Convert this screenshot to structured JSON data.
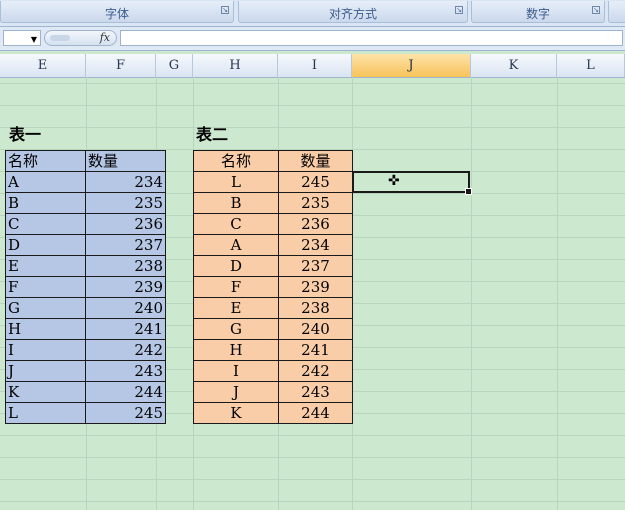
{
  "ribbon": {
    "groups": [
      {
        "label": "字体"
      },
      {
        "label": "对齐方式"
      },
      {
        "label": "数字"
      }
    ]
  },
  "formula_bar": {
    "name_box_value": "",
    "fx_label": "fx",
    "formula_value": ""
  },
  "columns": [
    "E",
    "F",
    "G",
    "H",
    "I",
    "J",
    "K",
    "L"
  ],
  "selected_column": "J",
  "table1": {
    "title": "表一",
    "headers": [
      "名称",
      "数量"
    ],
    "rows": [
      [
        "A",
        "234"
      ],
      [
        "B",
        "235"
      ],
      [
        "C",
        "236"
      ],
      [
        "D",
        "237"
      ],
      [
        "E",
        "238"
      ],
      [
        "F",
        "239"
      ],
      [
        "G",
        "240"
      ],
      [
        "H",
        "241"
      ],
      [
        "I",
        "242"
      ],
      [
        "J",
        "243"
      ],
      [
        "K",
        "244"
      ],
      [
        "L",
        "245"
      ]
    ]
  },
  "table2": {
    "title": "表二",
    "headers": [
      "名称",
      "数量"
    ],
    "rows": [
      [
        "L",
        "245"
      ],
      [
        "B",
        "235"
      ],
      [
        "C",
        "236"
      ],
      [
        "A",
        "234"
      ],
      [
        "D",
        "237"
      ],
      [
        "F",
        "239"
      ],
      [
        "E",
        "238"
      ],
      [
        "G",
        "240"
      ],
      [
        "H",
        "241"
      ],
      [
        "I",
        "242"
      ],
      [
        "J",
        "243"
      ],
      [
        "K",
        "244"
      ]
    ]
  },
  "colors": {
    "sheet_background": "#cce8cf",
    "table1_fill": "#b5c7e4",
    "table2_fill": "#f9cda8",
    "selected_column_header": "#f8c35a"
  },
  "icons": {
    "name_box_dropdown": "chevron-down-icon",
    "cell_cursor": "plus-cursor-icon"
  }
}
